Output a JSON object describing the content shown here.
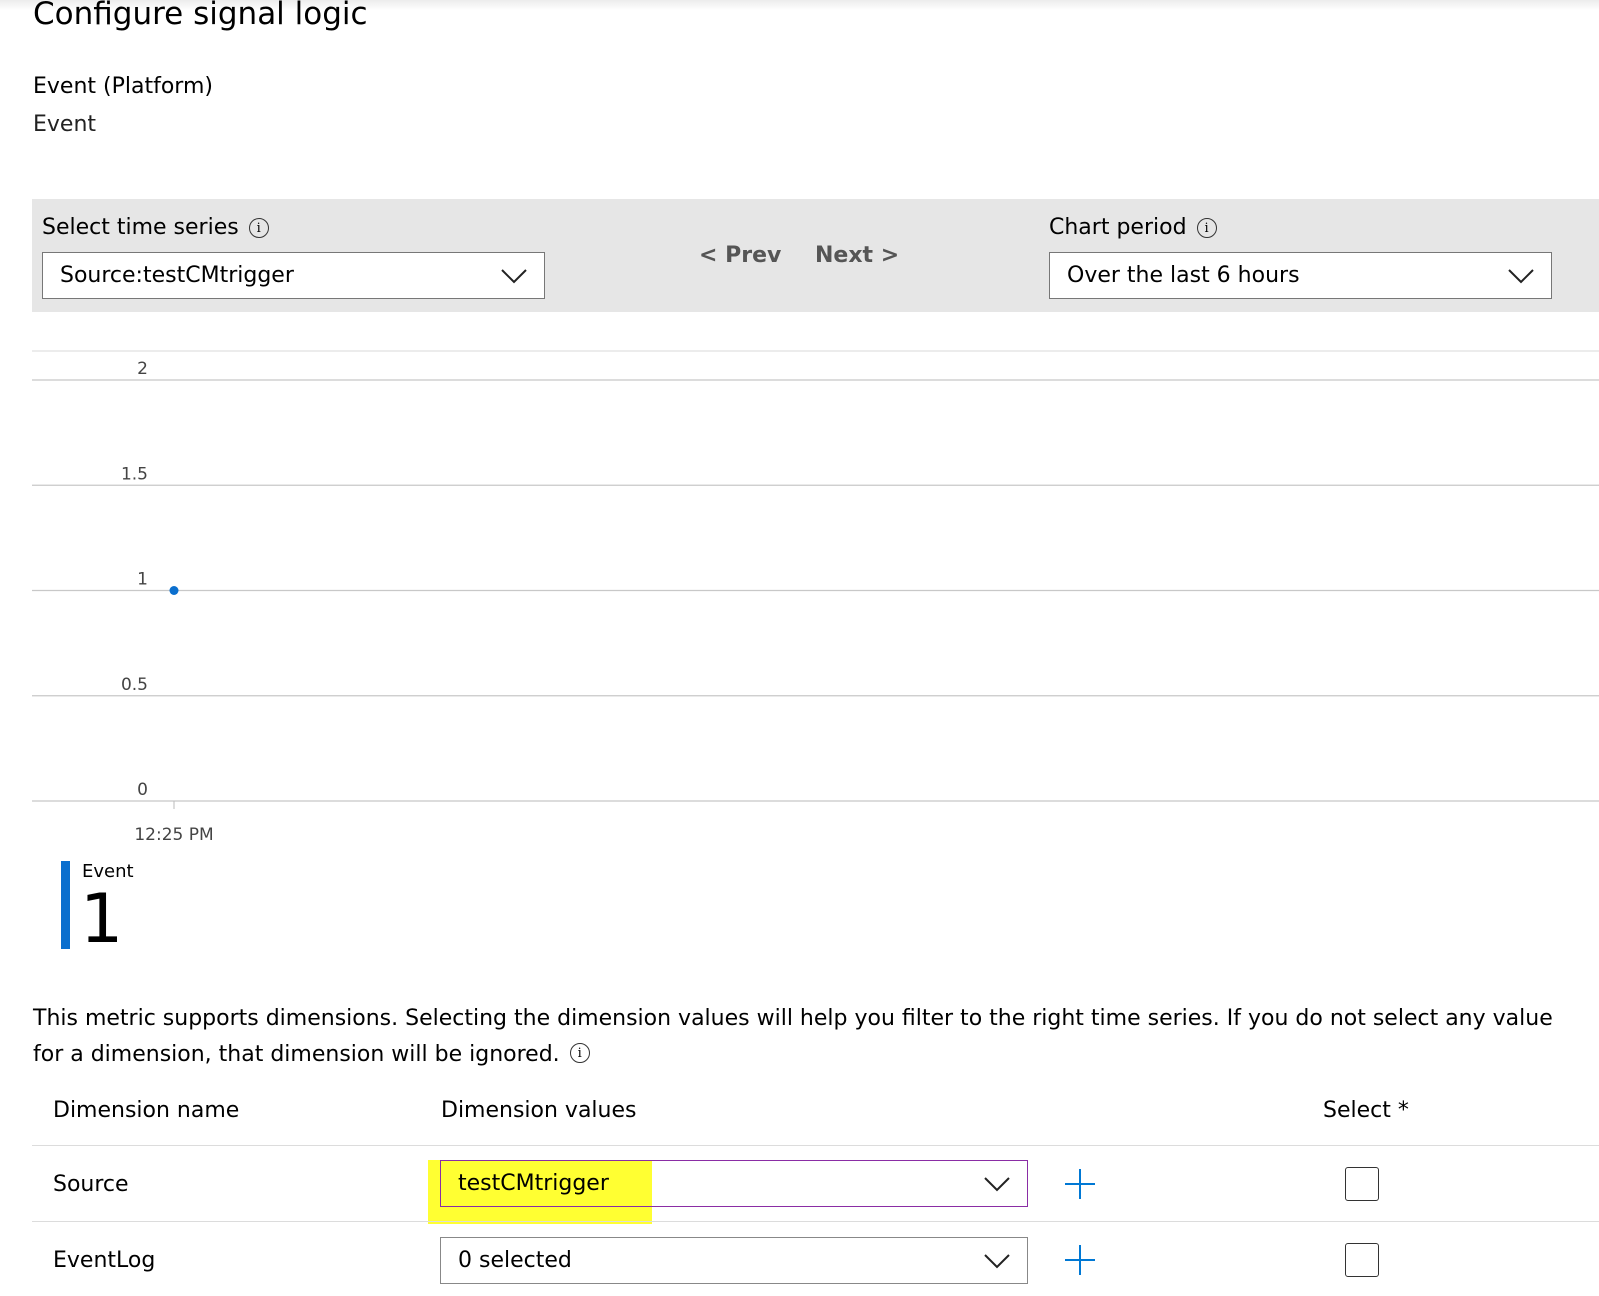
{
  "page": {
    "title": "Configure signal logic"
  },
  "signal": {
    "name": "Event (Platform)",
    "type": "Event"
  },
  "controls": {
    "time_series_label": "Select time series",
    "time_series_value": "Source:testCMtrigger",
    "prev_label": "< Prev",
    "next_label": "Next >",
    "chart_period_label": "Chart period",
    "chart_period_value": "Over the last 6 hours"
  },
  "chart_data": {
    "type": "scatter",
    "x": [
      "12:25 PM"
    ],
    "y": [
      1
    ],
    "yticks": [
      "2",
      "1.5",
      "1",
      "0.5",
      "0"
    ],
    "xticks": [
      "12:25 PM"
    ],
    "ylim": [
      0,
      2
    ],
    "grid": true,
    "series_color": "#0a6fce"
  },
  "legend": {
    "name": "Event",
    "value": "1",
    "color": "#0a6fce"
  },
  "dimensions": {
    "description": "This metric supports dimensions. Selecting the dimension values will help you filter to the right time series. If you do not select any value for a dimension, that dimension will be ignored.",
    "headers": {
      "name": "Dimension name",
      "values": "Dimension values",
      "select": "Select *"
    },
    "rows": [
      {
        "name": "Source",
        "value": "testCMtrigger",
        "highlighted": true
      },
      {
        "name": "EventLog",
        "value": "0 selected",
        "highlighted": false
      }
    ]
  },
  "colors": {
    "accent": "#0078d4",
    "focus_border": "#8a2da5",
    "highlight": "#ffff32",
    "panel": "#e6e6e6"
  }
}
